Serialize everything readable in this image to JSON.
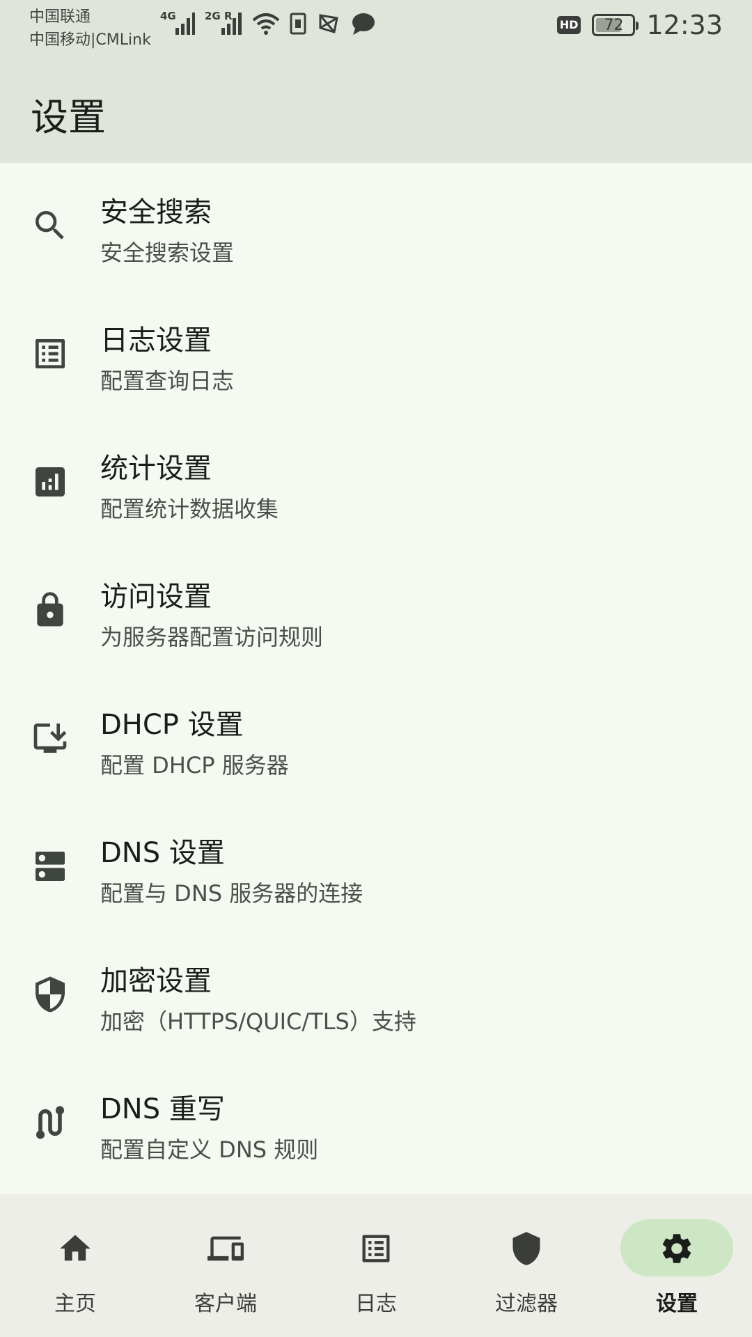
{
  "status_bar": {
    "carrier_1": "中国联通",
    "carrier_2": "中国移动|CMLink",
    "network_1": "4G",
    "network_2": "2G R",
    "hd": "HD",
    "battery": "72",
    "battery_level": 0.72,
    "time": "12:33"
  },
  "header": {
    "title": "设置"
  },
  "settings": [
    {
      "icon": "search-icon",
      "title": "安全搜索",
      "subtitle": "安全搜索设置"
    },
    {
      "icon": "list-icon",
      "title": "日志设置",
      "subtitle": "配置查询日志"
    },
    {
      "icon": "stats-icon",
      "title": "统计设置",
      "subtitle": "配置统计数据收集"
    },
    {
      "icon": "lock-icon",
      "title": "访问设置",
      "subtitle": "为服务器配置访问规则"
    },
    {
      "icon": "download-monitor-icon",
      "title": "DHCP 设置",
      "subtitle": "配置 DHCP 服务器"
    },
    {
      "icon": "dns-server-icon",
      "title": "DNS 设置",
      "subtitle": "配置与 DNS 服务器的连接"
    },
    {
      "icon": "shield-icon",
      "title": "加密设置",
      "subtitle": "加密（HTTPS/QUIC/TLS）支持"
    },
    {
      "icon": "route-icon",
      "title": "DNS 重写",
      "subtitle": "配置自定义 DNS 规则"
    }
  ],
  "nav": {
    "active": "设置",
    "items": [
      {
        "icon": "home-icon",
        "label": "主页"
      },
      {
        "icon": "devices-icon",
        "label": "客户端"
      },
      {
        "icon": "list-icon",
        "label": "日志"
      },
      {
        "icon": "shield-icon",
        "label": "过滤器"
      },
      {
        "icon": "gear-icon",
        "label": "设置"
      }
    ]
  },
  "colors": {
    "header_bg": "#dfe5da",
    "list_bg": "#f6f9f2",
    "icon": "#3f4540",
    "active_pill": "#cde7c4",
    "nav_bg": "#eceee7"
  }
}
